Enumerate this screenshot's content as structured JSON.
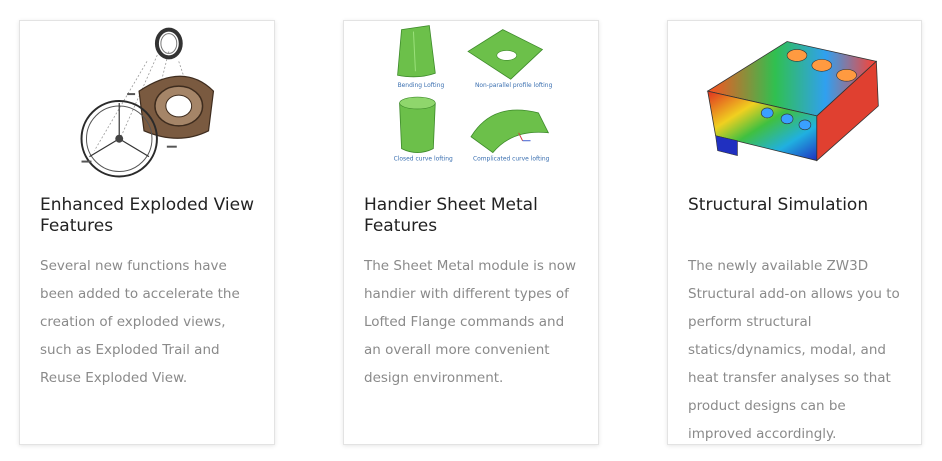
{
  "cards": [
    {
      "title": "Enhanced Exploded View Features",
      "description": "Several new functions have been added to accelerate the creation of exploded views, such as Exploded Trail and Reuse Exploded View.",
      "image": "exploded-assembly-illustration"
    },
    {
      "title": "Handier Sheet Metal Features",
      "description": "The Sheet Metal module is now handier with different types of Lofted Flange commands and an overall more convenient design environment.",
      "image": "sheet-metal-lofting-illustration",
      "image_captions": [
        "Bending Lofting",
        "Non-parallel profile lofting",
        "Closed curve lofting",
        "Complicated curve lofting"
      ]
    },
    {
      "title": "Structural Simulation",
      "description": "The newly available ZW3D Structural add-on allows you to perform structural statics/dynamics, modal, and heat transfer analyses so that product designs can be improved accordingly.",
      "image": "structural-simulation-heatmap"
    }
  ],
  "colors": {
    "title": "#222222",
    "description": "#8a8a8a",
    "card_border": "#e3e3e3",
    "sheet_metal_green": "#6cc04a",
    "caption_blue": "#3a6fb0"
  }
}
